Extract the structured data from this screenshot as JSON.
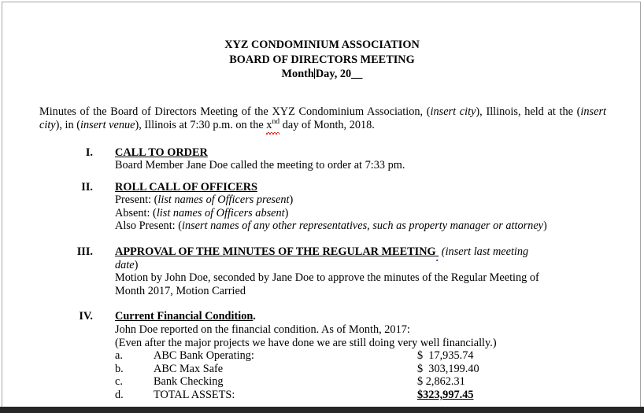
{
  "document": {
    "title_lines": [
      "XYZ CONDOMINIUM ASSOCIATION",
      "BOARD OF DIRECTORS MEETING"
    ],
    "date_line": {
      "before_caret": "Month",
      "after_caret": "Day, 20",
      "blank": "__"
    },
    "intro_paragraph": {
      "part1": "Minutes of the Board of Directors Meeting of the XYZ Condominium Association, (",
      "italic1": "insert city",
      "part2": "), Illinois, held at the (",
      "italic2": "insert city",
      "part3": "), in (",
      "italic3": "insert venue",
      "part4": "), Illinois at 7:30 p.m. on the ",
      "misspelled_base": "x",
      "misspelled_sup": "nd",
      "part5": " day of Month, 2018."
    },
    "sections": [
      {
        "numeral": "I.",
        "heading": "CALL TO ORDER",
        "lines": [
          "Board Member Jane Doe called the meeting to order at 7:33 pm."
        ]
      },
      {
        "numeral": "II.",
        "heading": "ROLL CALL OF OFFICERS",
        "roll": [
          {
            "label": "Present: (",
            "italic": "list names of Officers present",
            "close": ")"
          },
          {
            "label": "Absent: (",
            "italic": "list names of Officers absent",
            "close": ")"
          },
          {
            "label": "Also Present: (",
            "italic": "insert names of any other representatives, such as property manager or attorney",
            "close": ")"
          }
        ]
      },
      {
        "numeral": "III.",
        "heading": "APPROVAL OF THE MINUTES OF THE REGULAR MEETING",
        "heading_suffix_italic": " (insert last meeting",
        "heading_suffix_italic2": "date",
        "heading_suffix_close": ")",
        "lines": [
          "Motion by John Doe, seconded by Jane Doe to approve the minutes of the Regular Meeting of",
          "Month 2017, Motion Carried"
        ]
      },
      {
        "numeral": "IV.",
        "heading": "Current Financial Condition",
        "heading_period": ".",
        "lines": [
          "John Doe reported on the financial condition. As of Month, 2017:",
          "(Even after the major projects we have done we are still doing very well financially.)"
        ],
        "financials": [
          {
            "letter": "a.",
            "label": "ABC Bank Operating:",
            "amount": "$  17,935.74"
          },
          {
            "letter": "b.",
            "label": "ABC Max Safe",
            "amount": "$  303,199.40"
          },
          {
            "letter": "c.",
            "label": "Bank Checking",
            "amount": "$ 2,862.31"
          },
          {
            "letter": "d.",
            "label": "TOTAL ASSETS:",
            "amount": "$323,997.45"
          }
        ]
      }
    ]
  },
  "colors": {
    "page_border": "#a6a6a6",
    "spellcheck_red": "#e01b1b",
    "grammar_blue": "#2b4ea8",
    "bottom_edge": "#272727"
  }
}
